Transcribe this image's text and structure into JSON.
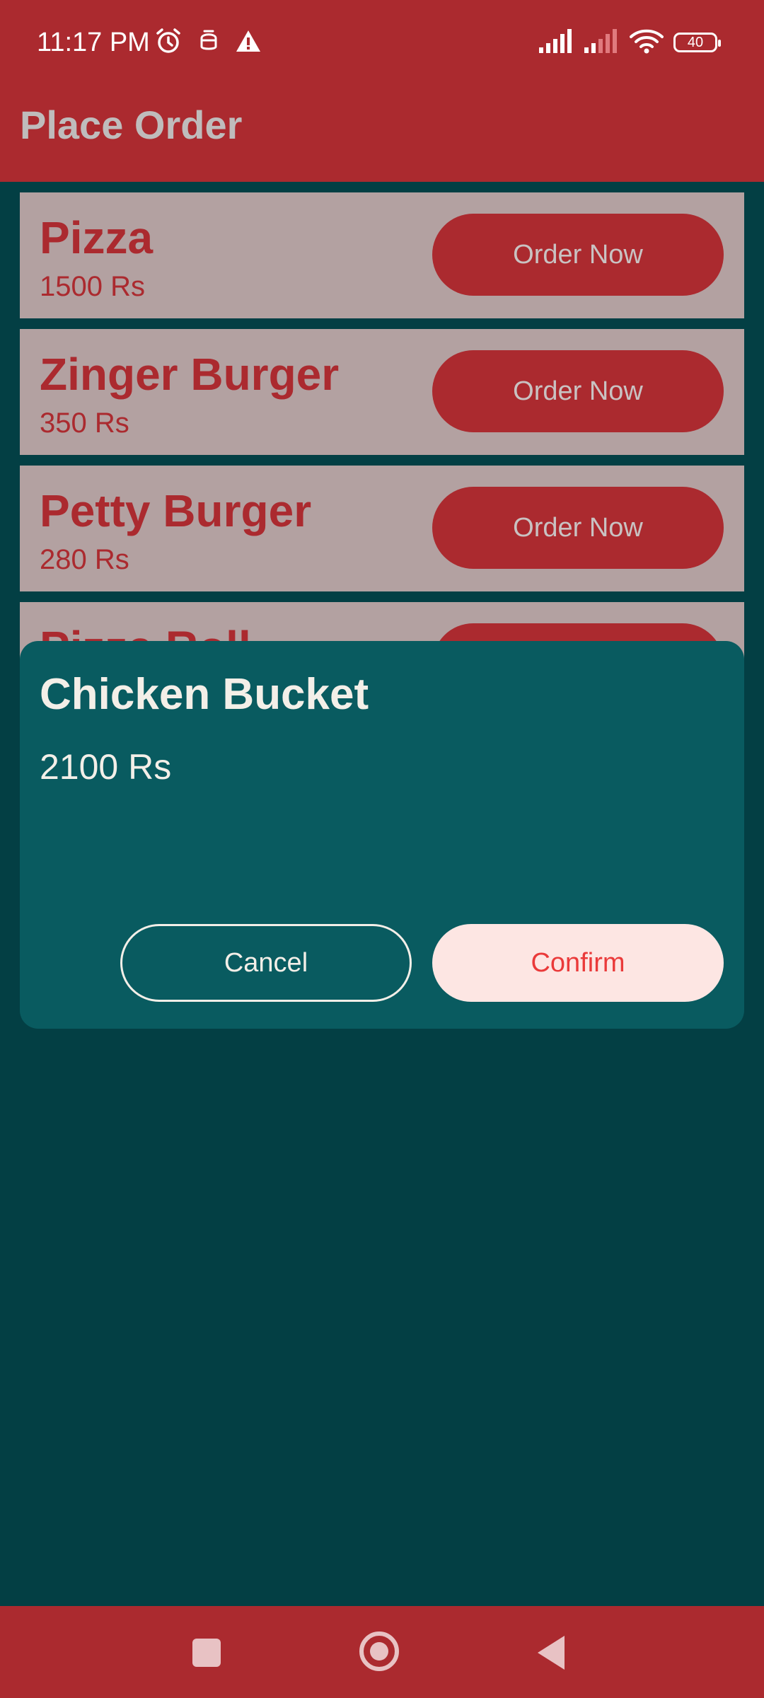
{
  "status_bar": {
    "time": "11:17 PM",
    "battery_level": "40",
    "icons": [
      "alarm-icon",
      "notification-icon",
      "warning-icon",
      "cellular-signal-icon",
      "cellular-signal-2-icon",
      "wifi-icon",
      "battery-icon"
    ]
  },
  "app_bar": {
    "title": "Place Order"
  },
  "menu": {
    "items": [
      {
        "name": "Pizza",
        "price": "1500 Rs",
        "button_label": "Order Now"
      },
      {
        "name": "Zinger Burger",
        "price": "350 Rs",
        "button_label": "Order Now"
      },
      {
        "name": "Petty Burger",
        "price": "280 Rs",
        "button_label": "Order Now"
      },
      {
        "name": "Pizza Roll",
        "price": "",
        "button_label": "Order Now"
      }
    ]
  },
  "dialog": {
    "title": "Chicken Bucket",
    "price": "2100 Rs",
    "cancel_label": "Cancel",
    "confirm_label": "Confirm"
  },
  "navigation_bar": {
    "icons": [
      "recent-apps-icon",
      "home-icon",
      "back-icon"
    ]
  },
  "colors": {
    "primary": "#ab2a2f",
    "background": "#033f44",
    "card": "#b3a1a1",
    "dialog": "#095b60",
    "confirm_background": "#fde6e3",
    "confirm_text": "#ea3a3a"
  }
}
